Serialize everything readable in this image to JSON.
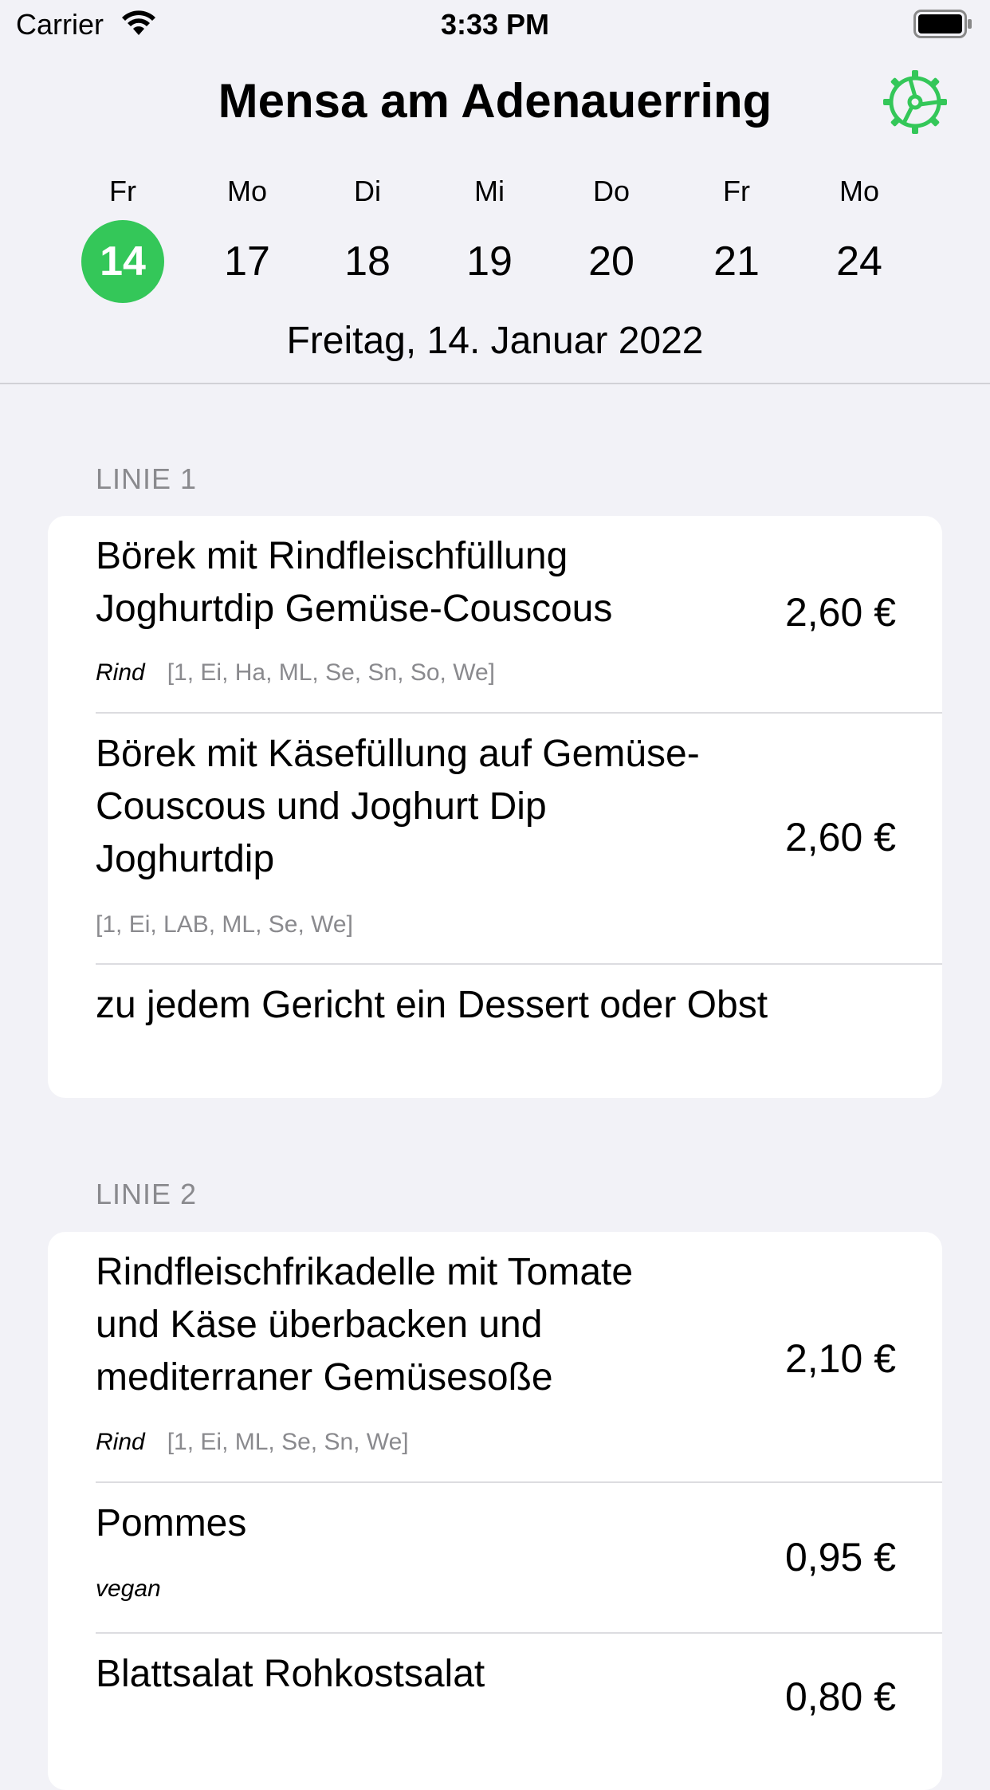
{
  "status_bar": {
    "carrier": "Carrier",
    "time": "3:33 PM"
  },
  "header": {
    "title": "Mensa am Adenauerring",
    "days": [
      {
        "weekday": "Fr",
        "day": "14",
        "selected": true
      },
      {
        "weekday": "Mo",
        "day": "17"
      },
      {
        "weekday": "Di",
        "day": "18"
      },
      {
        "weekday": "Mi",
        "day": "19"
      },
      {
        "weekday": "Do",
        "day": "20"
      },
      {
        "weekday": "Fr",
        "day": "21"
      },
      {
        "weekday": "Mo",
        "day": "24"
      }
    ],
    "full_date": "Freitag, 14. Januar 2022"
  },
  "accent_color": "#34c759",
  "sections": [
    {
      "label": "LINIE 1",
      "meals": [
        {
          "name_lines": [
            "Börek mit Rindfleischfüllung",
            "Joghurtdip Gemüse-Couscous"
          ],
          "tag": "Rind",
          "additives": "[1, Ei, Ha, ML, Se, Sn, So, We]",
          "price": "2,60 €"
        },
        {
          "name_lines": [
            "Börek mit Käsefüllung auf Gemüse-",
            "Couscous und Joghurt Dip",
            "Joghurtdip"
          ],
          "tag": "",
          "additives": "[1, Ei, LAB, ML, Se, We]",
          "price": "2,60 €"
        },
        {
          "name_lines": [
            "zu jedem Gericht ein Dessert oder Obst"
          ],
          "tag": "",
          "additives": "",
          "price": ""
        }
      ]
    },
    {
      "label": "LINIE 2",
      "meals": [
        {
          "name_lines": [
            "Rindfleischfrikadelle mit Tomate",
            "und Käse überbacken und",
            "mediterraner Gemüsesoße"
          ],
          "tag": "Rind",
          "additives": "[1, Ei, ML, Se, Sn, We]",
          "price": "2,10 €"
        },
        {
          "name_lines": [
            "Pommes"
          ],
          "tag": "vegan",
          "additives": "",
          "price": "0,95 €"
        },
        {
          "name_lines": [
            "Blattsalat Rohkostsalat"
          ],
          "tag": "",
          "additives": "",
          "price": "0,80 €"
        }
      ]
    }
  ]
}
